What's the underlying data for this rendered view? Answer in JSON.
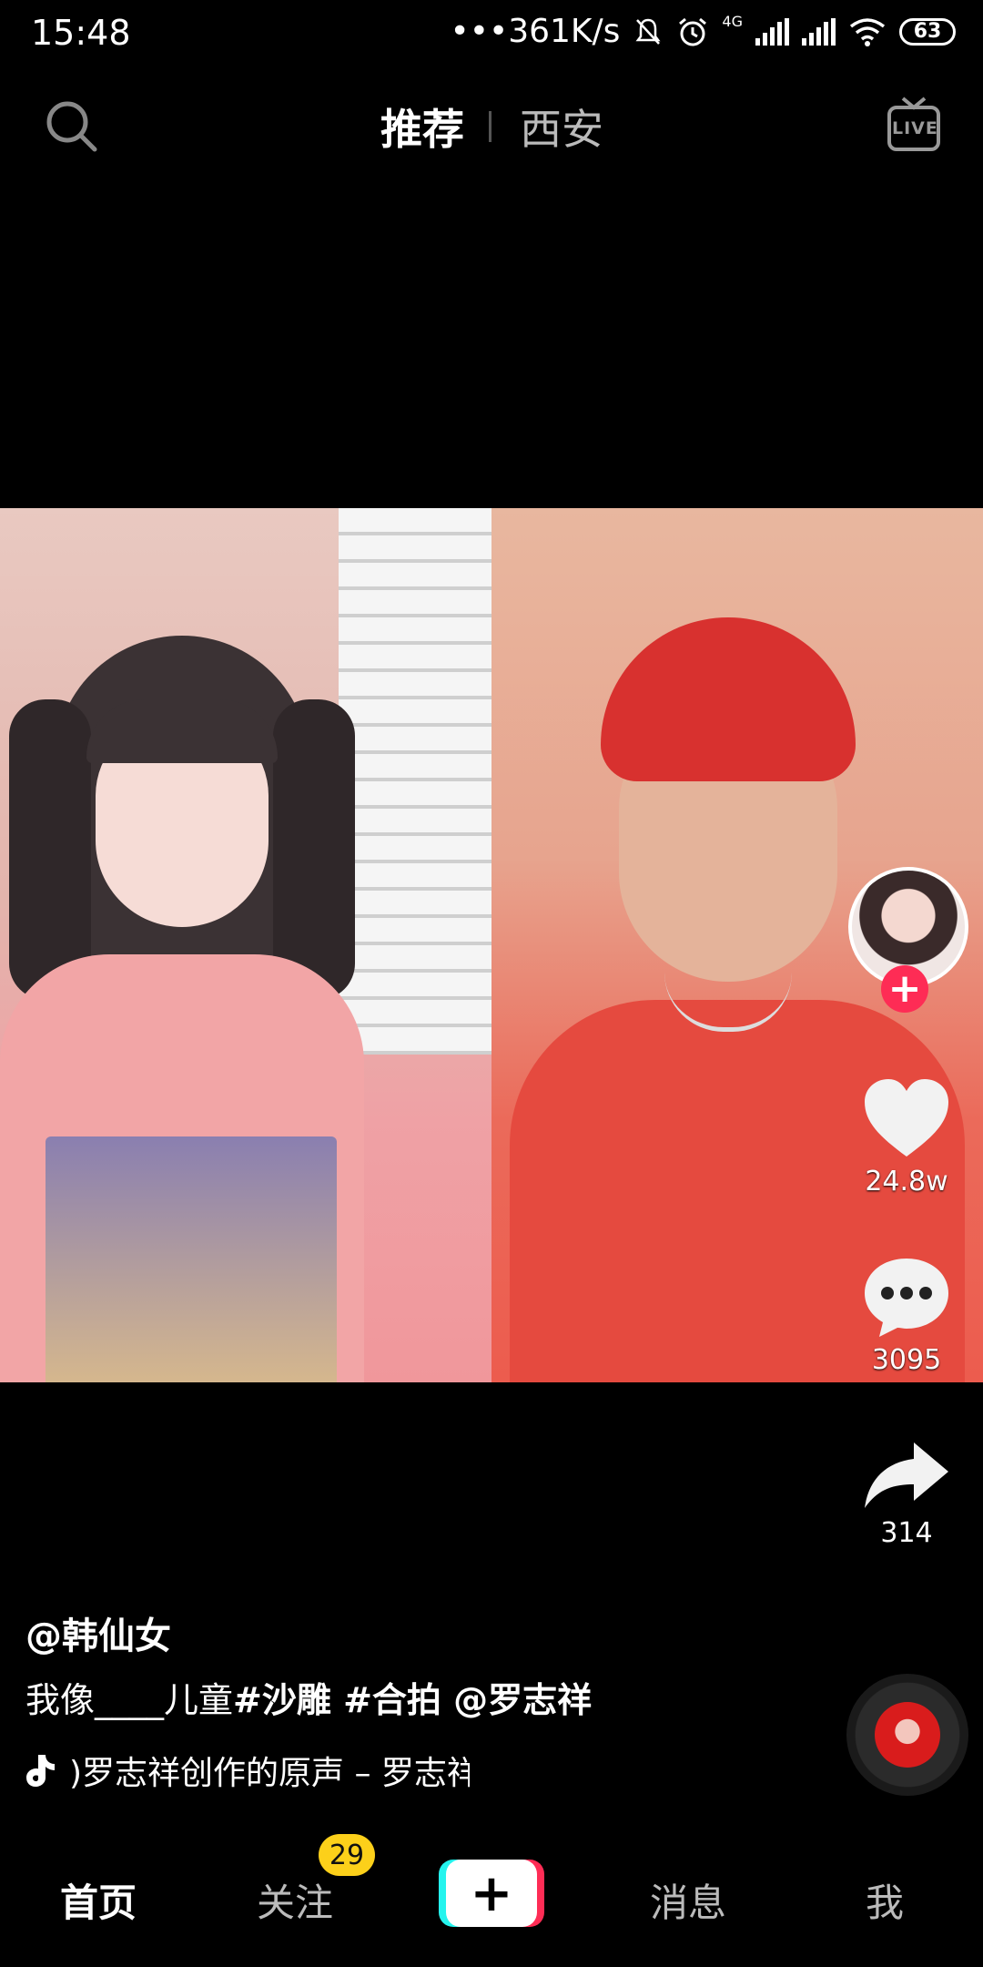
{
  "status_bar": {
    "time": "15:48",
    "net_speed": "•••361K/s",
    "network_type": "4G",
    "battery": "63"
  },
  "top_nav": {
    "tab_recommend": "推荐",
    "tab_city": "西安",
    "live_label": "LIVE"
  },
  "actions": {
    "likes": "24.8w",
    "comments": "3095",
    "shares": "314"
  },
  "post": {
    "author": "@韩仙女",
    "desc_prefix": "我像____儿童",
    "tags": "#沙雕 #合拍 @罗志祥",
    "music": ")罗志祥创作的原声 – 罗志祥"
  },
  "bottom_nav": {
    "home": "首页",
    "follow": "关注",
    "follow_badge": "29",
    "messages": "消息",
    "me": "我"
  },
  "colors": {
    "accent": "#fe2c55",
    "badge": "#fcd01a",
    "cyan": "#25f4ee"
  }
}
